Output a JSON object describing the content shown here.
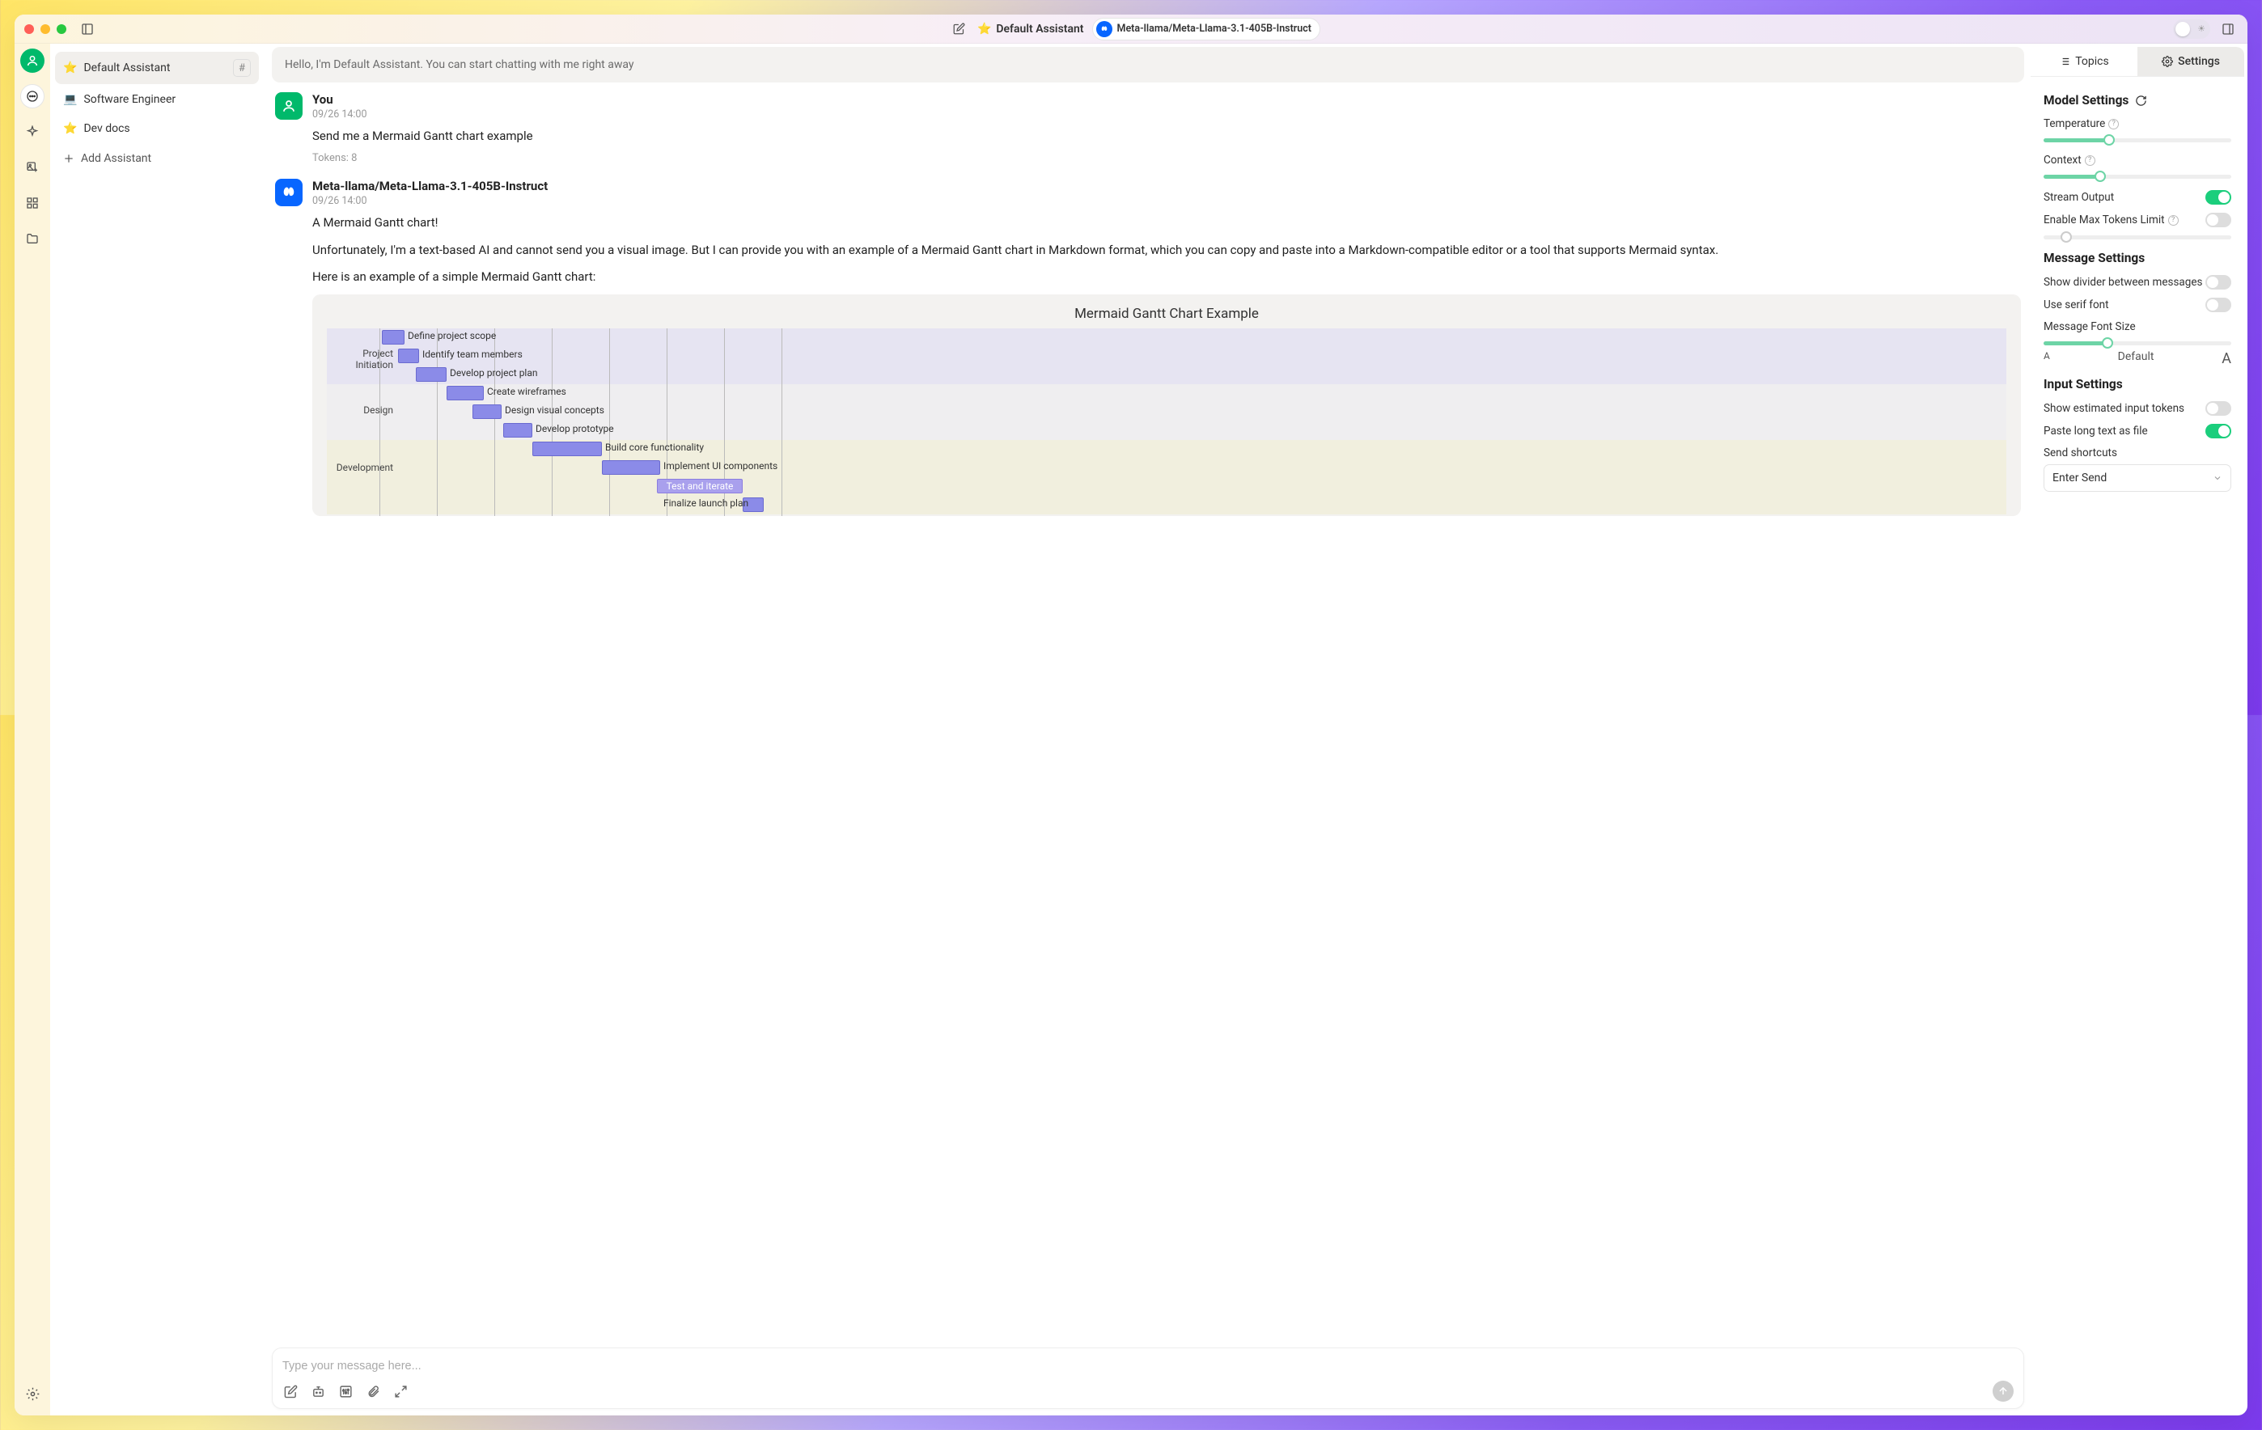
{
  "titlebar": {
    "assistant_name": "Default Assistant",
    "model_name": "Meta-llama/Meta-Llama-3.1-405B-Instruct"
  },
  "assistants": {
    "items": [
      {
        "emoji": "⭐",
        "label": "Default Assistant",
        "selected": true
      },
      {
        "emoji": "💻",
        "label": "Software Engineer",
        "selected": false
      },
      {
        "emoji": "⭐",
        "label": "Dev docs",
        "selected": false
      }
    ],
    "add_label": "Add Assistant"
  },
  "chat": {
    "greeting": "Hello, I'm Default Assistant. You can start chatting with me right away",
    "input_placeholder": "Type your message here...",
    "messages": [
      {
        "role": "user",
        "name": "You",
        "time": "09/26 14:00",
        "text": "Send me a Mermaid Gantt chart example",
        "tokens": "Tokens: 8"
      },
      {
        "role": "assistant",
        "name": "Meta-llama/Meta-Llama-3.1-405B-Instruct",
        "time": "09/26 14:00",
        "paragraphs": [
          "A Mermaid Gantt chart!",
          "Unfortunately, I'm a text-based AI and cannot send you a visual image. But I can provide you with an example of a Mermaid Gantt chart in Markdown format, which you can copy and paste into a Markdown-compatible editor or a tool that supports Mermaid syntax.",
          "Here is an example of a simple Mermaid Gantt chart:"
        ]
      }
    ]
  },
  "chart_data": {
    "type": "gantt",
    "title": "Mermaid Gantt Chart Example",
    "sections": [
      {
        "name": "Project Initiation",
        "tasks": [
          "Define project scope",
          "Identify team members",
          "Develop project plan"
        ]
      },
      {
        "name": "Design",
        "tasks": [
          "Create wireframes",
          "Design visual concepts",
          "Develop prototype"
        ]
      },
      {
        "name": "Development",
        "tasks": [
          "Build core functionality",
          "Implement UI components",
          "Test and iterate",
          "Finalize launch plan"
        ]
      }
    ]
  },
  "settings": {
    "tabs": {
      "topics": "Topics",
      "settings": "Settings"
    },
    "model_heading": "Model Settings",
    "temperature_label": "Temperature",
    "temperature_pct": 35,
    "context_label": "Context",
    "context_pct": 30,
    "stream_label": "Stream Output",
    "stream_on": true,
    "max_tokens_label": "Enable Max Tokens Limit",
    "max_tokens_on": false,
    "max_tokens_slider_pct": 12,
    "message_heading": "Message Settings",
    "divider_label": "Show divider between messages",
    "divider_on": false,
    "serif_label": "Use serif font",
    "serif_on": false,
    "font_size_label": "Message Font Size",
    "font_size_pct": 34,
    "font_size_center": "Default",
    "input_heading": "Input Settings",
    "est_tokens_label": "Show estimated input tokens",
    "est_tokens_on": false,
    "paste_file_label": "Paste long text as file",
    "paste_file_on": true,
    "shortcuts_label": "Send shortcuts",
    "shortcuts_value": "Enter Send"
  }
}
